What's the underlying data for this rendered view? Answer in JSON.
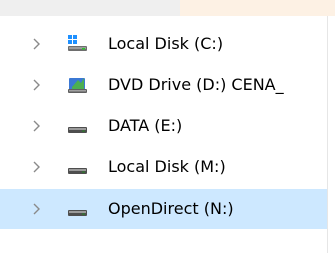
{
  "tree": {
    "items": [
      {
        "label": "Local Disk (C:)",
        "icon": "windows-drive-icon",
        "selected": false
      },
      {
        "label": "DVD Drive (D:) CENA_",
        "icon": "dvd-drive-icon",
        "selected": false
      },
      {
        "label": "DATA (E:)",
        "icon": "hard-drive-icon",
        "selected": false
      },
      {
        "label": "Local Disk (M:)",
        "icon": "hard-drive-icon",
        "selected": false
      },
      {
        "label": "OpenDirect (N:)",
        "icon": "hard-drive-icon",
        "selected": true
      }
    ]
  }
}
